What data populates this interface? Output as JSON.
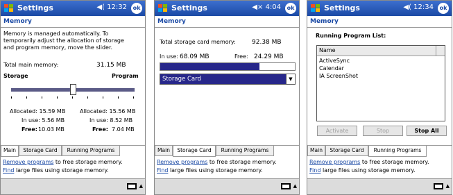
{
  "screens": [
    {
      "title": "Settings",
      "status": "◀( 12:32",
      "ok": "ok",
      "heading": "Memory",
      "intro": [
        "Memory is managed automatically. To",
        "temporarily adjust the allocation of storage",
        "and program memory, move the slider."
      ],
      "total_label": "Total main memory:",
      "total_value": "31.15 MB",
      "storage_label": "Storage",
      "program_label": "Program",
      "slider_value": 0.49,
      "left": {
        "allocated": "Allocated: 15.59 MB",
        "inuse": "In use: 5.56 MB",
        "free_label": "Free:",
        "free_value": "10.03 MB"
      },
      "right": {
        "allocated": "Allocated: 15.56 MB",
        "inuse": "In use: 8.52 MB",
        "free_label": "Free:",
        "free_value": "7.04 MB"
      },
      "tabs": [
        "Main",
        "Storage Card",
        "Running Programs"
      ],
      "link1": "Remove programs",
      "link1_rest": "to free storage memory.",
      "link2": "Find",
      "link2_rest": "large files using storage memory."
    },
    {
      "title": "Settings",
      "status": "◀× 4:04",
      "ok": "ok",
      "heading": "Memory",
      "total_label": "Total storage card memory:",
      "total_value": "92.38 MB",
      "inuse_label": "In use:",
      "inuse_value": "68.09 MB",
      "free_label": "Free:",
      "free_value": "24.29 MB",
      "used_fraction": 0.737,
      "select_value": "Storage Card",
      "tabs": [
        "Main",
        "Storage Card",
        "Running Programs"
      ],
      "link1": "Remove programs",
      "link1_rest": "to free storage memory.",
      "link2": "Find",
      "link2_rest": "large files using storage memory."
    },
    {
      "title": "Settings",
      "status": "◀( 12:34",
      "ok": "ok",
      "heading": "Memory",
      "list_title": "Running Program List:",
      "column": "Name",
      "programs": [
        "ActiveSync",
        "Calendar",
        "IA ScreenShot"
      ],
      "activate": "Activate",
      "stop": "Stop",
      "stop_all": "Stop All",
      "tabs": [
        "Main",
        "Storage Card",
        "Running Programs"
      ],
      "link1": "Remove programs",
      "link1_rest": "to free storage memory.",
      "link2": "Find",
      "link2_rest": "large files using storage memory."
    }
  ]
}
